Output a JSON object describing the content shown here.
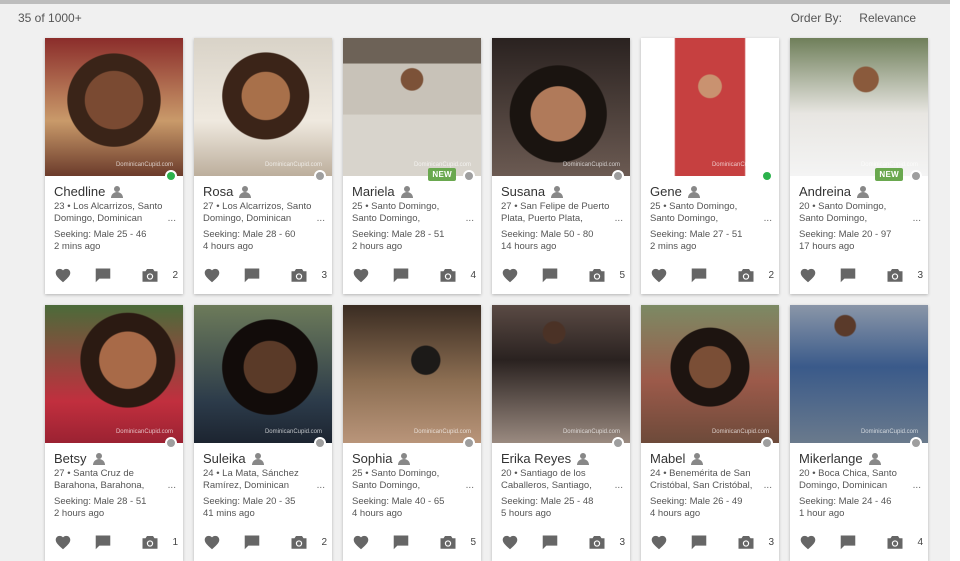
{
  "header": {
    "results_count": "35 of 1000+",
    "order_by_label": "Order By:",
    "order_by_value": "Relevance"
  },
  "profiles": [
    {
      "name": "Chedline",
      "location": "23 • Los Alcarrizos, Santo Domingo, Dominican",
      "seeking": "Seeking: Male 25 - 46",
      "last_seen": "2 mins ago",
      "photos": "2",
      "status": "online",
      "is_new": false,
      "new_label": ""
    },
    {
      "name": "Rosa",
      "location": "27 • Los Alcarrizos, Santo Domingo, Dominican",
      "seeking": "Seeking: Male 28 - 60",
      "last_seen": "4 hours ago",
      "photos": "3",
      "status": "offline",
      "is_new": false,
      "new_label": ""
    },
    {
      "name": "Mariela",
      "location": "25 • Santo Domingo, Santo Domingo,",
      "seeking": "Seeking: Male 28 - 51",
      "last_seen": "2 hours ago",
      "photos": "4",
      "status": "offline",
      "is_new": true,
      "new_label": "NEW"
    },
    {
      "name": "Susana",
      "location": "27 • San Felipe de Puerto Plata, Puerto Plata,",
      "seeking": "Seeking: Male 50 - 80",
      "last_seen": "14 hours ago",
      "photos": "5",
      "status": "offline",
      "is_new": false,
      "new_label": ""
    },
    {
      "name": "Gene",
      "location": "25 • Santo Domingo, Santo Domingo,",
      "seeking": "Seeking: Male 27 - 51",
      "last_seen": "2 mins ago",
      "photos": "2",
      "status": "online",
      "is_new": false,
      "new_label": ""
    },
    {
      "name": "Andreina",
      "location": "20 • Santo Domingo, Santo Domingo,",
      "seeking": "Seeking: Male 20 - 97",
      "last_seen": "17 hours ago",
      "photos": "3",
      "status": "offline",
      "is_new": true,
      "new_label": "NEW"
    },
    {
      "name": "Betsy",
      "location": "27 • Santa Cruz de Barahona, Barahona,",
      "seeking": "Seeking: Male 28 - 51",
      "last_seen": "2 hours ago",
      "photos": "1",
      "status": "offline",
      "is_new": false,
      "new_label": ""
    },
    {
      "name": "Suleika",
      "location": "24 • La Mata, Sánchez Ramírez, Dominican",
      "seeking": "Seeking: Male 20 - 35",
      "last_seen": "41 mins ago",
      "photos": "2",
      "status": "offline",
      "is_new": false,
      "new_label": ""
    },
    {
      "name": "Sophia",
      "location": "25 • Santo Domingo, Santo Domingo,",
      "seeking": "Seeking: Male 40 - 65",
      "last_seen": "4 hours ago",
      "photos": "5",
      "status": "offline",
      "is_new": false,
      "new_label": ""
    },
    {
      "name": "Erika Reyes",
      "location": "20 • Santiago de los Caballeros, Santiago,",
      "seeking": "Seeking: Male 25 - 48",
      "last_seen": "5 hours ago",
      "photos": "3",
      "status": "offline",
      "is_new": false,
      "new_label": ""
    },
    {
      "name": "Mabel",
      "location": "24 • Benemérita de San Cristóbal, San Cristóbal,",
      "seeking": "Seeking: Male 26 - 49",
      "last_seen": "4 hours ago",
      "photos": "3",
      "status": "offline",
      "is_new": false,
      "new_label": ""
    },
    {
      "name": "Mikerlange",
      "location": "20 • Boca Chica, Santo Domingo, Dominican",
      "seeking": "Seeking: Male 24 - 46",
      "last_seen": "1 hour ago",
      "photos": "4",
      "status": "offline",
      "is_new": false,
      "new_label": ""
    }
  ],
  "card_ui": {
    "more_glyph": "...",
    "watermark": "DominicanCupid.com",
    "icons": {
      "heart": "heart-icon",
      "chat": "chat-icon",
      "camera": "camera-icon",
      "user": "user-icon"
    }
  },
  "colors": {
    "online": "#2bb24c",
    "offline": "#9e9e9e",
    "new_badge": "#6aa84f",
    "icon_gray": "#666666",
    "card_bg": "#ffffff",
    "page_bg": "#f0f0f0"
  }
}
